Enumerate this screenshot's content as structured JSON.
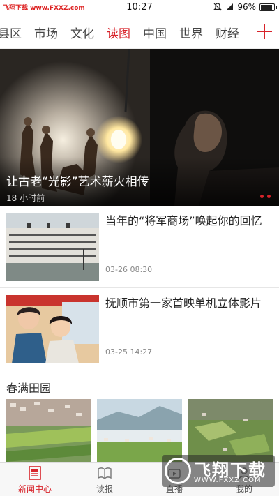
{
  "status_bar": {
    "watermark": "飞翔下载 www.FXXZ.com",
    "time": "10:27",
    "battery": "96%",
    "battery_level": 0.96
  },
  "channels": {
    "items": [
      "县区",
      "市场",
      "文化",
      "读图",
      "中国",
      "世界",
      "财经"
    ],
    "active": "读图"
  },
  "hero": {
    "title": "让古老“光影”艺术薪火相传",
    "time": "18 小时前"
  },
  "news": [
    {
      "title": "当年的“将军商场”唤起你的回忆",
      "time": "03-26 08:30"
    },
    {
      "title": "抚顺市第一家首映单机立体影片",
      "time": "03-25 14:27"
    }
  ],
  "section": {
    "title": "春满田园"
  },
  "bottom_nav": {
    "items": [
      {
        "label": "新闻中心"
      },
      {
        "label": "读报"
      },
      {
        "label": "直播"
      },
      {
        "label": "我的"
      }
    ]
  },
  "watermark_bottom": {
    "brand": "飞翔下载",
    "url": "WWW.FXXZ.COM"
  },
  "colors": {
    "accent": "#d8232a"
  }
}
